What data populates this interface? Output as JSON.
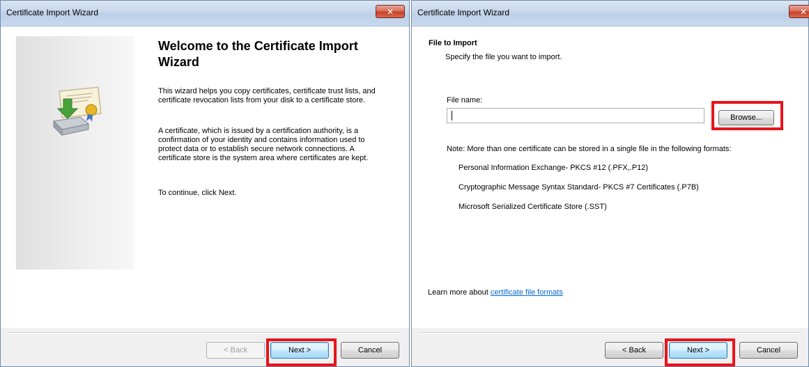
{
  "window1": {
    "title": "Certificate Import Wizard",
    "close_label": "✕",
    "heading": "Welcome to the Certificate Import Wizard",
    "para1": "This wizard helps you copy certificates, certificate trust lists, and certificate revocation lists from your disk to a certificate store.",
    "para2": "A certificate, which is issued by a certification authority, is a confirmation of your identity and contains information used to protect data or to establish secure network connections. A certificate store is the system area where certificates are kept.",
    "para3": "To continue, click Next.",
    "buttons": {
      "back": "< Back",
      "next": "Next >",
      "cancel": "Cancel"
    },
    "back_enabled": false
  },
  "window2": {
    "title": "Certificate Import Wizard",
    "close_label": "✕",
    "page_title": "File to Import",
    "page_subtitle": "Specify the file you want to import.",
    "file_name_label": "File name:",
    "file_name_value": "",
    "browse_label": "Browse...",
    "note": "Note:  More than one certificate can be stored in a single file in the following formats:",
    "formats": [
      "Personal Information Exchange- PKCS #12 (.PFX,.P12)",
      "Cryptographic Message Syntax Standard- PKCS #7 Certificates (.P7B)",
      "Microsoft Serialized Certificate Store (.SST)"
    ],
    "learn_more_prefix": "Learn more about",
    "learn_more_link": "certificate file formats",
    "buttons": {
      "back": "< Back",
      "next": "Next >",
      "cancel": "Cancel"
    }
  },
  "colors": {
    "highlight": "#e8141b",
    "link": "#0066cc"
  },
  "icons": {
    "wizard": "certificate-install-icon",
    "close": "close-icon"
  }
}
